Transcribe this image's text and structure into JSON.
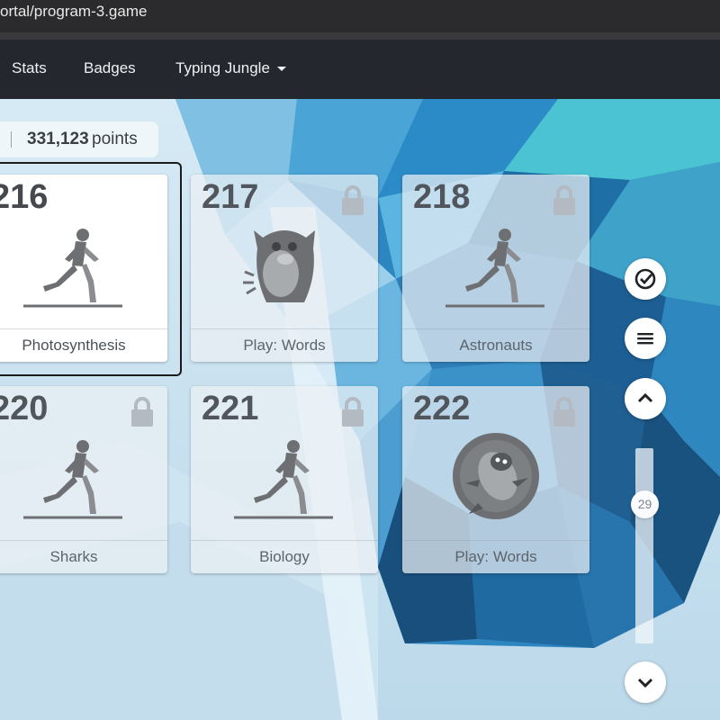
{
  "browser": {
    "url": "ortal/program-3.game"
  },
  "nav": {
    "items": [
      {
        "label": "Stats"
      },
      {
        "label": "Badges"
      },
      {
        "label": "Typing Jungle"
      }
    ]
  },
  "score": {
    "points_value": "331,123",
    "points_label": "points"
  },
  "cards": [
    {
      "number": "216",
      "title": "Photosynthesis",
      "locked": false,
      "icon": "runner-icon",
      "selected": true
    },
    {
      "number": "217",
      "title": "Play: Words",
      "locked": true,
      "icon": "yeti-icon"
    },
    {
      "number": "218",
      "title": "Astronauts",
      "locked": true,
      "icon": "runner-icon"
    },
    {
      "number": "220",
      "title": "Sharks",
      "locked": true,
      "icon": "runner-icon"
    },
    {
      "number": "221",
      "title": "Biology",
      "locked": true,
      "icon": "runner-icon"
    },
    {
      "number": "222",
      "title": "Play: Words",
      "locked": true,
      "icon": "penguin-icon"
    }
  ],
  "side_controls": {
    "check_icon": "check-circle-icon",
    "menu_icon": "hamburger-icon",
    "up_icon": "chevron-up-icon",
    "down_icon": "chevron-down-icon",
    "scroll_value": "29"
  },
  "colors": {
    "nav_bg": "#24282e",
    "accent_blue": "#2a8fc4",
    "card_text": "#45494e"
  }
}
